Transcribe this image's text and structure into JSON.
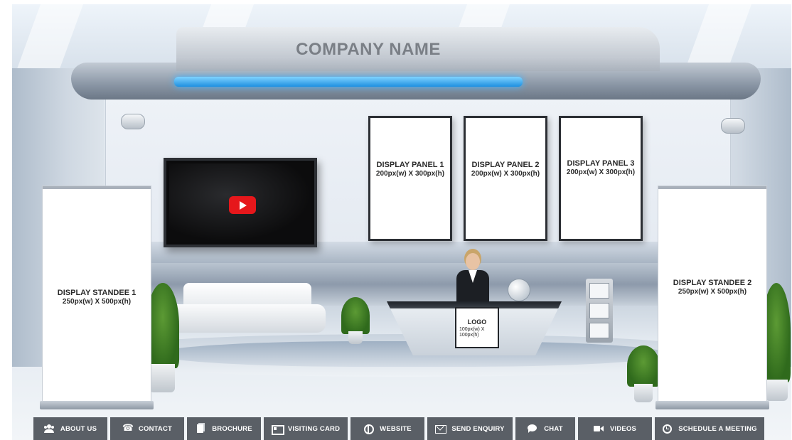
{
  "booth": {
    "company_name": "COMPANY NAME",
    "panels": [
      {
        "title": "DISPLAY  PANEL 1",
        "size": "200px(w) X 300px(h)"
      },
      {
        "title": "DISPLAY  PANEL 2",
        "size": "200px(w) X 300px(h)"
      },
      {
        "title": "DISPLAY  PANEL 3",
        "size": "200px(w) X 300px(h)"
      }
    ],
    "standees": [
      {
        "title": "DISPLAY STANDEE 1",
        "size": "250px(w) X 500px(h)"
      },
      {
        "title": "DISPLAY STANDEE 2",
        "size": "250px(w) X 500px(h)"
      }
    ],
    "logo": {
      "title": "LOGO",
      "size_line1": "100px(w) X",
      "size_line2": "100px(h)"
    },
    "video_icon": "youtube-play-icon"
  },
  "toolbar": {
    "buttons": [
      {
        "label": "ABOUT US",
        "icon": "users-icon"
      },
      {
        "label": "CONTACT",
        "icon": "phone-icon"
      },
      {
        "label": "BROCHURE",
        "icon": "document-icon"
      },
      {
        "label": "VISITING CARD",
        "icon": "id-card-icon"
      },
      {
        "label": "WEBSITE",
        "icon": "globe-icon"
      },
      {
        "label": "SEND ENQUIRY",
        "icon": "mail-icon"
      },
      {
        "label": "CHAT",
        "icon": "chat-icon"
      },
      {
        "label": "VIDEOS",
        "icon": "video-camera-icon"
      },
      {
        "label": "SCHEDULE A MEETING",
        "icon": "clock-icon"
      }
    ]
  },
  "colors": {
    "toolbar_bg": "#5a5f66",
    "accent_glow": "#1e90e0",
    "youtube_red": "#e6171b"
  }
}
